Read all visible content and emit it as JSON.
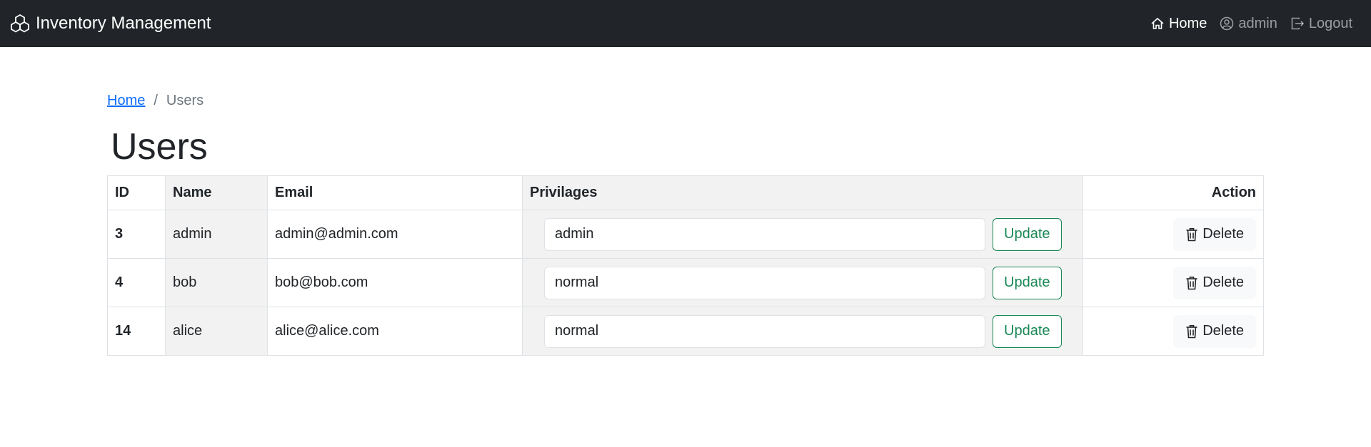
{
  "navbar": {
    "brand": "Inventory Management",
    "brand_icon": "boxes-icon",
    "items": [
      {
        "label": "Home",
        "icon": "house-icon",
        "active": true
      },
      {
        "label": "admin",
        "icon": "person-circle-icon",
        "active": false
      },
      {
        "label": "Logout",
        "icon": "box-arrow-right-icon",
        "active": false
      }
    ]
  },
  "breadcrumb": {
    "home": "Home",
    "separator": "/",
    "current": "Users"
  },
  "page_title": "Users",
  "table": {
    "headers": {
      "id": "ID",
      "name": "Name",
      "email": "Email",
      "privilages": "Privilages",
      "action": "Action"
    },
    "update_label": "Update",
    "delete_label": "Delete",
    "rows": [
      {
        "id": "3",
        "name": "admin",
        "email": "admin@admin.com",
        "privilage": "admin"
      },
      {
        "id": "4",
        "name": "bob",
        "email": "bob@bob.com",
        "privilage": "normal"
      },
      {
        "id": "14",
        "name": "alice",
        "email": "alice@alice.com",
        "privilage": "normal"
      }
    ]
  },
  "colors": {
    "navbar_bg": "#212529",
    "link": "#0d6efd",
    "update_button": "#198754"
  }
}
